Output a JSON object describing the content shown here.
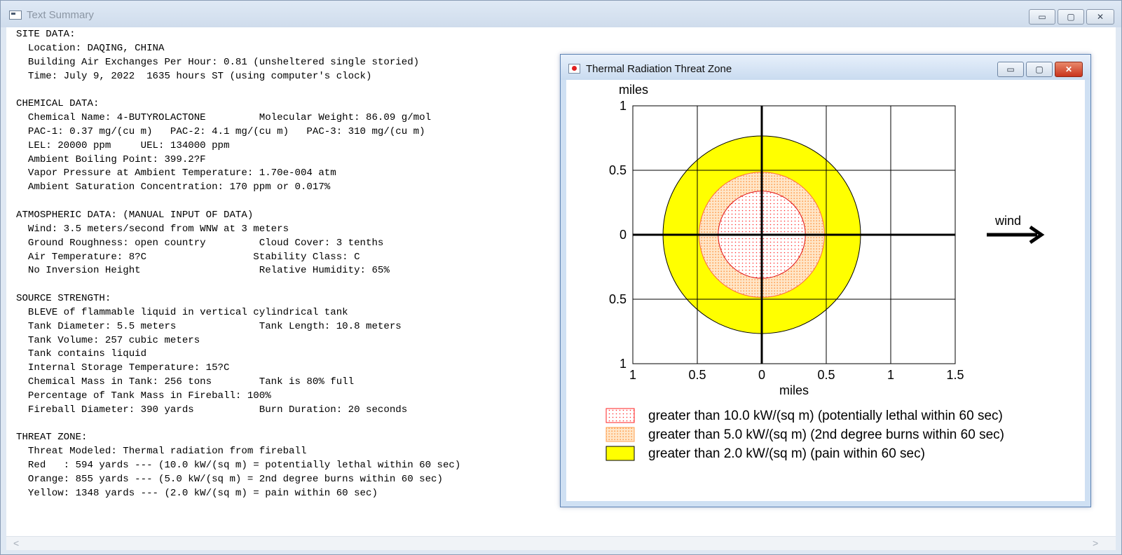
{
  "main_window": {
    "title": "Text Summary",
    "buttons": {
      "minimize": "▭",
      "maximize": "▢",
      "close": "✕"
    }
  },
  "summary_lines": [
    "SITE DATA:",
    "  Location: DAQING, CHINA",
    "  Building Air Exchanges Per Hour: 0.81 (unsheltered single storied)",
    "  Time: July 9, 2022  1635 hours ST (using computer's clock)",
    "",
    "CHEMICAL DATA:",
    "  Chemical Name: 4-BUTYROLACTONE         Molecular Weight: 86.09 g/mol",
    "  PAC-1: 0.37 mg/(cu m)   PAC-2: 4.1 mg/(cu m)   PAC-3: 310 mg/(cu m)",
    "  LEL: 20000 ppm     UEL: 134000 ppm",
    "  Ambient Boiling Point: 399.2?F",
    "  Vapor Pressure at Ambient Temperature: 1.70e-004 atm",
    "  Ambient Saturation Concentration: 170 ppm or 0.017%",
    "",
    "ATMOSPHERIC DATA: (MANUAL INPUT OF DATA)",
    "  Wind: 3.5 meters/second from WNW at 3 meters",
    "  Ground Roughness: open country         Cloud Cover: 3 tenths",
    "  Air Temperature: 8?C                  Stability Class: C",
    "  No Inversion Height                    Relative Humidity: 65%",
    "",
    "SOURCE STRENGTH:",
    "  BLEVE of flammable liquid in vertical cylindrical tank",
    "  Tank Diameter: 5.5 meters              Tank Length: 10.8 meters",
    "  Tank Volume: 257 cubic meters",
    "  Tank contains liquid",
    "  Internal Storage Temperature: 15?C",
    "  Chemical Mass in Tank: 256 tons        Tank is 80% full",
    "  Percentage of Tank Mass in Fireball: 100%",
    "  Fireball Diameter: 390 yards           Burn Duration: 20 seconds",
    "",
    "THREAT ZONE:",
    "  Threat Modeled: Thermal radiation from fireball",
    "  Red   : 594 yards --- (10.0 kW/(sq m) = potentially lethal within 60 sec)",
    "  Orange: 855 yards --- (5.0 kW/(sq m) = 2nd degree burns within 60 sec)",
    "  Yellow: 1348 yards --- (2.0 kW/(sq m) = pain within 60 sec)"
  ],
  "scrollbar": {
    "left_arrow": "<",
    "right_arrow": ">"
  },
  "thermal_window": {
    "title": "Thermal Radiation Threat Zone",
    "buttons": {
      "minimize": "▭",
      "maximize": "▢",
      "close": "✕"
    }
  },
  "chart_data": {
    "type": "threat-zone-plot",
    "x_unit_label": "miles",
    "y_unit_label": "miles",
    "x_tick_labels": [
      "1",
      "0.5",
      "0",
      "0.5",
      "1",
      "1.5"
    ],
    "x_tick_values": [
      -1,
      -0.5,
      0,
      0.5,
      1,
      1.5
    ],
    "y_tick_labels": [
      "1",
      "0.5",
      "0",
      "0.5",
      "1"
    ],
    "y_tick_values": [
      1,
      0.5,
      0,
      -0.5,
      -1
    ],
    "xlim": [
      -1,
      1.5
    ],
    "ylim": [
      -1,
      1
    ],
    "grid": true,
    "wind_label": "wind",
    "zones": [
      {
        "name": "Yellow",
        "radius_miles": 0.766,
        "color": "#ffff00",
        "pattern": "solid"
      },
      {
        "name": "Orange",
        "radius_miles": 0.486,
        "color": "#ffc078",
        "pattern": "dots"
      },
      {
        "name": "Red",
        "radius_miles": 0.338,
        "color": "#ff3030",
        "pattern": "dots"
      }
    ],
    "legend": [
      {
        "text": "greater than 10.0 kW/(sq m) (potentially lethal within 60 sec)",
        "color": "#ff2020",
        "pattern": "dots"
      },
      {
        "text": "greater than 5.0 kW/(sq m) (2nd degree burns within 60 sec)",
        "color": "#ffb060",
        "pattern": "dots"
      },
      {
        "text": "greater than 2.0 kW/(sq m) (pain within 60 sec)",
        "color": "#ffff00",
        "pattern": "solid"
      }
    ]
  }
}
